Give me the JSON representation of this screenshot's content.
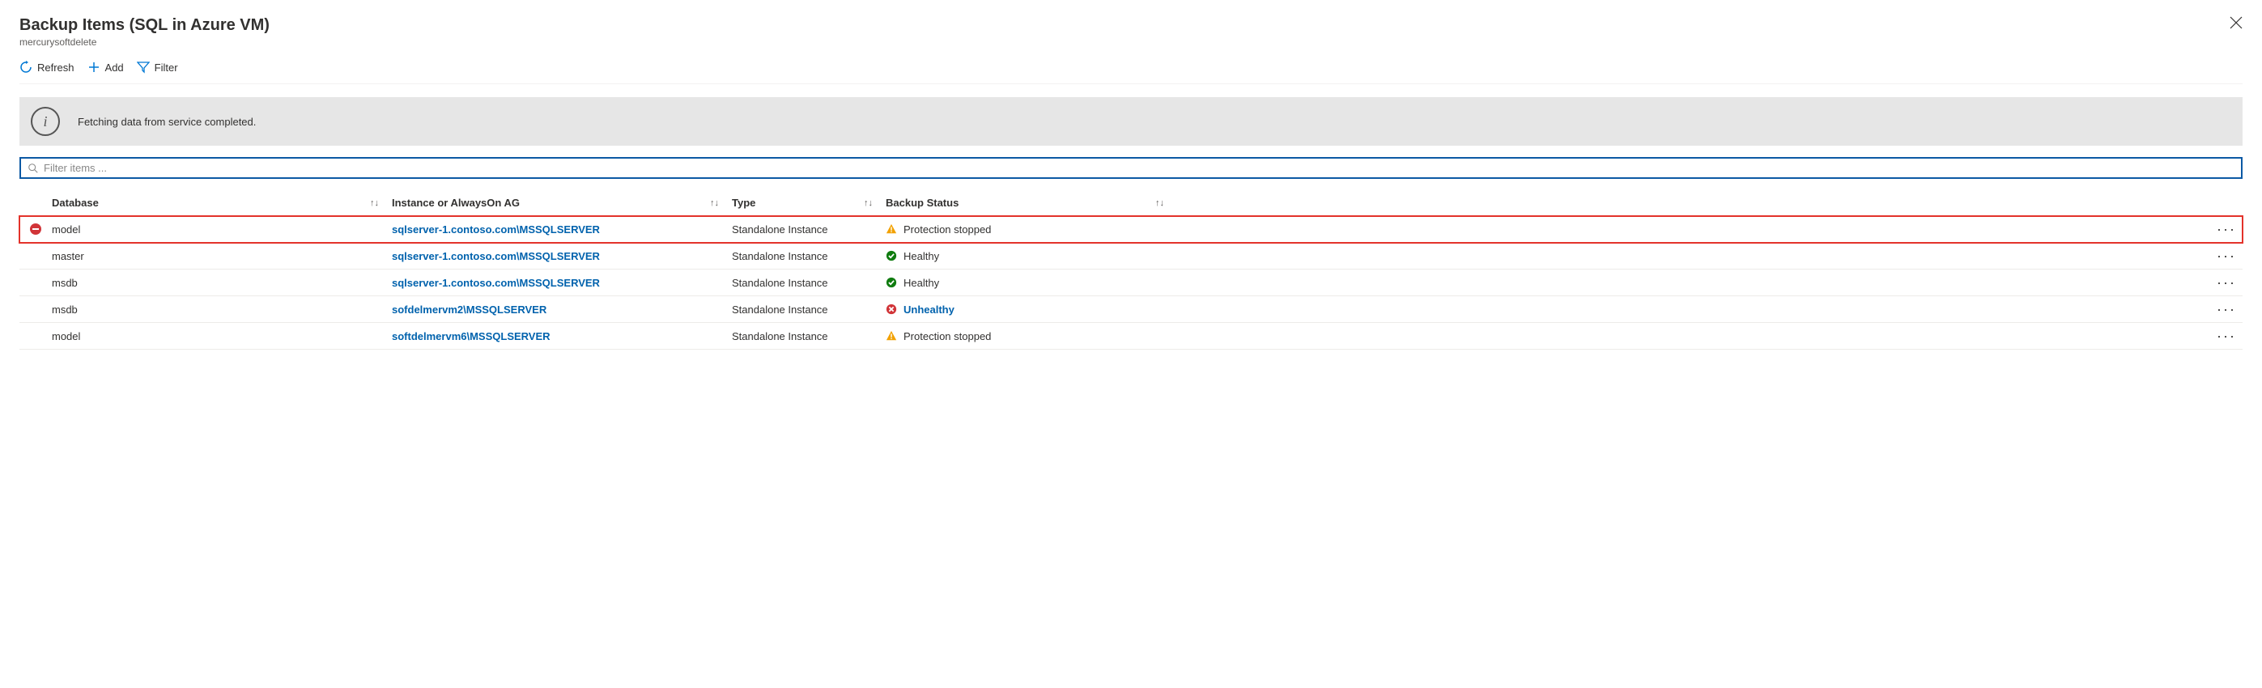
{
  "header": {
    "title": "Backup Items (SQL in Azure VM)",
    "subtitle": "mercurysoftdelete"
  },
  "toolbar": {
    "refresh": "Refresh",
    "add": "Add",
    "filter": "Filter"
  },
  "banner": {
    "message": "Fetching data from service completed."
  },
  "filter_placeholder": "Filter items ...",
  "columns": {
    "database": "Database",
    "instance": "Instance or AlwaysOn AG",
    "type": "Type",
    "status": "Backup Status"
  },
  "rows": [
    {
      "database": "model",
      "instance": "sqlserver-1.contoso.com\\MSSQLSERVER",
      "type": "Standalone Instance",
      "status_icon": "warn",
      "status": "Protection stopped",
      "pre_icon": "stop",
      "highlight": true
    },
    {
      "database": "master",
      "instance": "sqlserver-1.contoso.com\\MSSQLSERVER",
      "type": "Standalone Instance",
      "status_icon": "ok",
      "status": "Healthy"
    },
    {
      "database": "msdb",
      "instance": "sqlserver-1.contoso.com\\MSSQLSERVER",
      "type": "Standalone Instance",
      "status_icon": "ok",
      "status": "Healthy"
    },
    {
      "database": "msdb",
      "instance": "sofdelmervm2\\MSSQLSERVER",
      "type": "Standalone Instance",
      "status_icon": "error",
      "status": "Unhealthy",
      "status_link": true
    },
    {
      "database": "model",
      "instance": "softdelmervm6\\MSSQLSERVER",
      "type": "Standalone Instance",
      "status_icon": "warn",
      "status": "Protection stopped"
    }
  ]
}
